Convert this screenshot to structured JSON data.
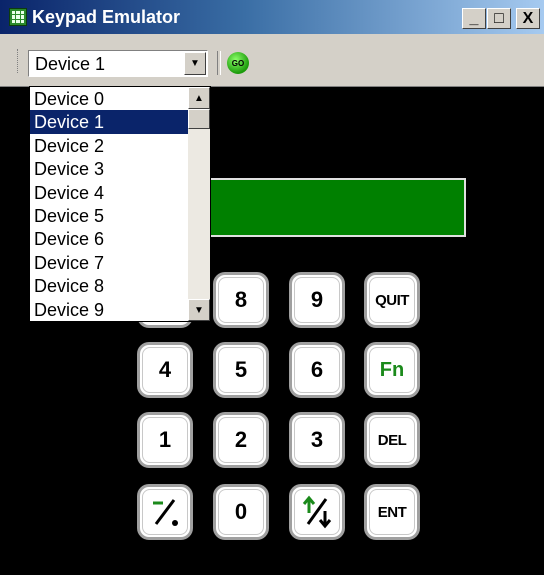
{
  "window": {
    "title": "Keypad Emulator",
    "controls": {
      "minimize": "_",
      "maximize": "□",
      "close": "X"
    }
  },
  "toolbar": {
    "device_select": {
      "value": "Device 1"
    },
    "go_button": {
      "label": "GO",
      "icon": "go-icon"
    }
  },
  "dropdown": {
    "options": [
      "Device 0",
      "Device 1",
      "Device 2",
      "Device 3",
      "Device 4",
      "Device 5",
      "Device 6",
      "Device 7",
      "Device 8",
      "Device 9"
    ],
    "selected_index": 1
  },
  "keypad": {
    "rows": [
      [
        "8",
        "9",
        "QUIT"
      ],
      [
        "4",
        "5",
        "6",
        "Fn"
      ],
      [
        "1",
        "2",
        "3",
        "DEL"
      ],
      [
        "−/.",
        "0",
        "↑/↓",
        "ENT"
      ]
    ]
  },
  "colors": {
    "lcd": "#008000",
    "selection": "#0a246a",
    "fn_text": "#1b8a1b",
    "titlebar_start": "#0a246a",
    "titlebar_end": "#a6caf0"
  }
}
